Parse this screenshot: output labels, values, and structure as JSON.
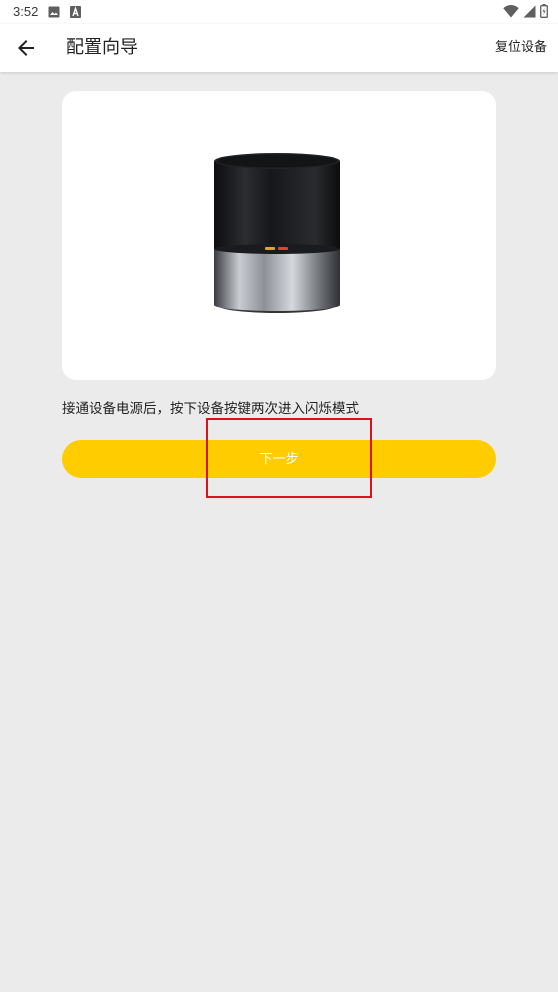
{
  "status_bar": {
    "time": "3:52",
    "icons": [
      "image-notification-icon",
      "a-notification-icon",
      "wifi-icon",
      "signal-icon",
      "battery-icon"
    ]
  },
  "app_bar": {
    "title": "配置向导",
    "reset_label": "复位设备",
    "back_icon": "arrow-left-icon"
  },
  "main": {
    "device_image": "ir-remote-hub-device",
    "instruction": "接通设备电源后，按下设备按键两次进入闪烁模式",
    "next_button_label": "下一步"
  },
  "colors": {
    "background": "#ebebeb",
    "accent": "#ffcc00",
    "highlight_box": "#d9131b"
  }
}
